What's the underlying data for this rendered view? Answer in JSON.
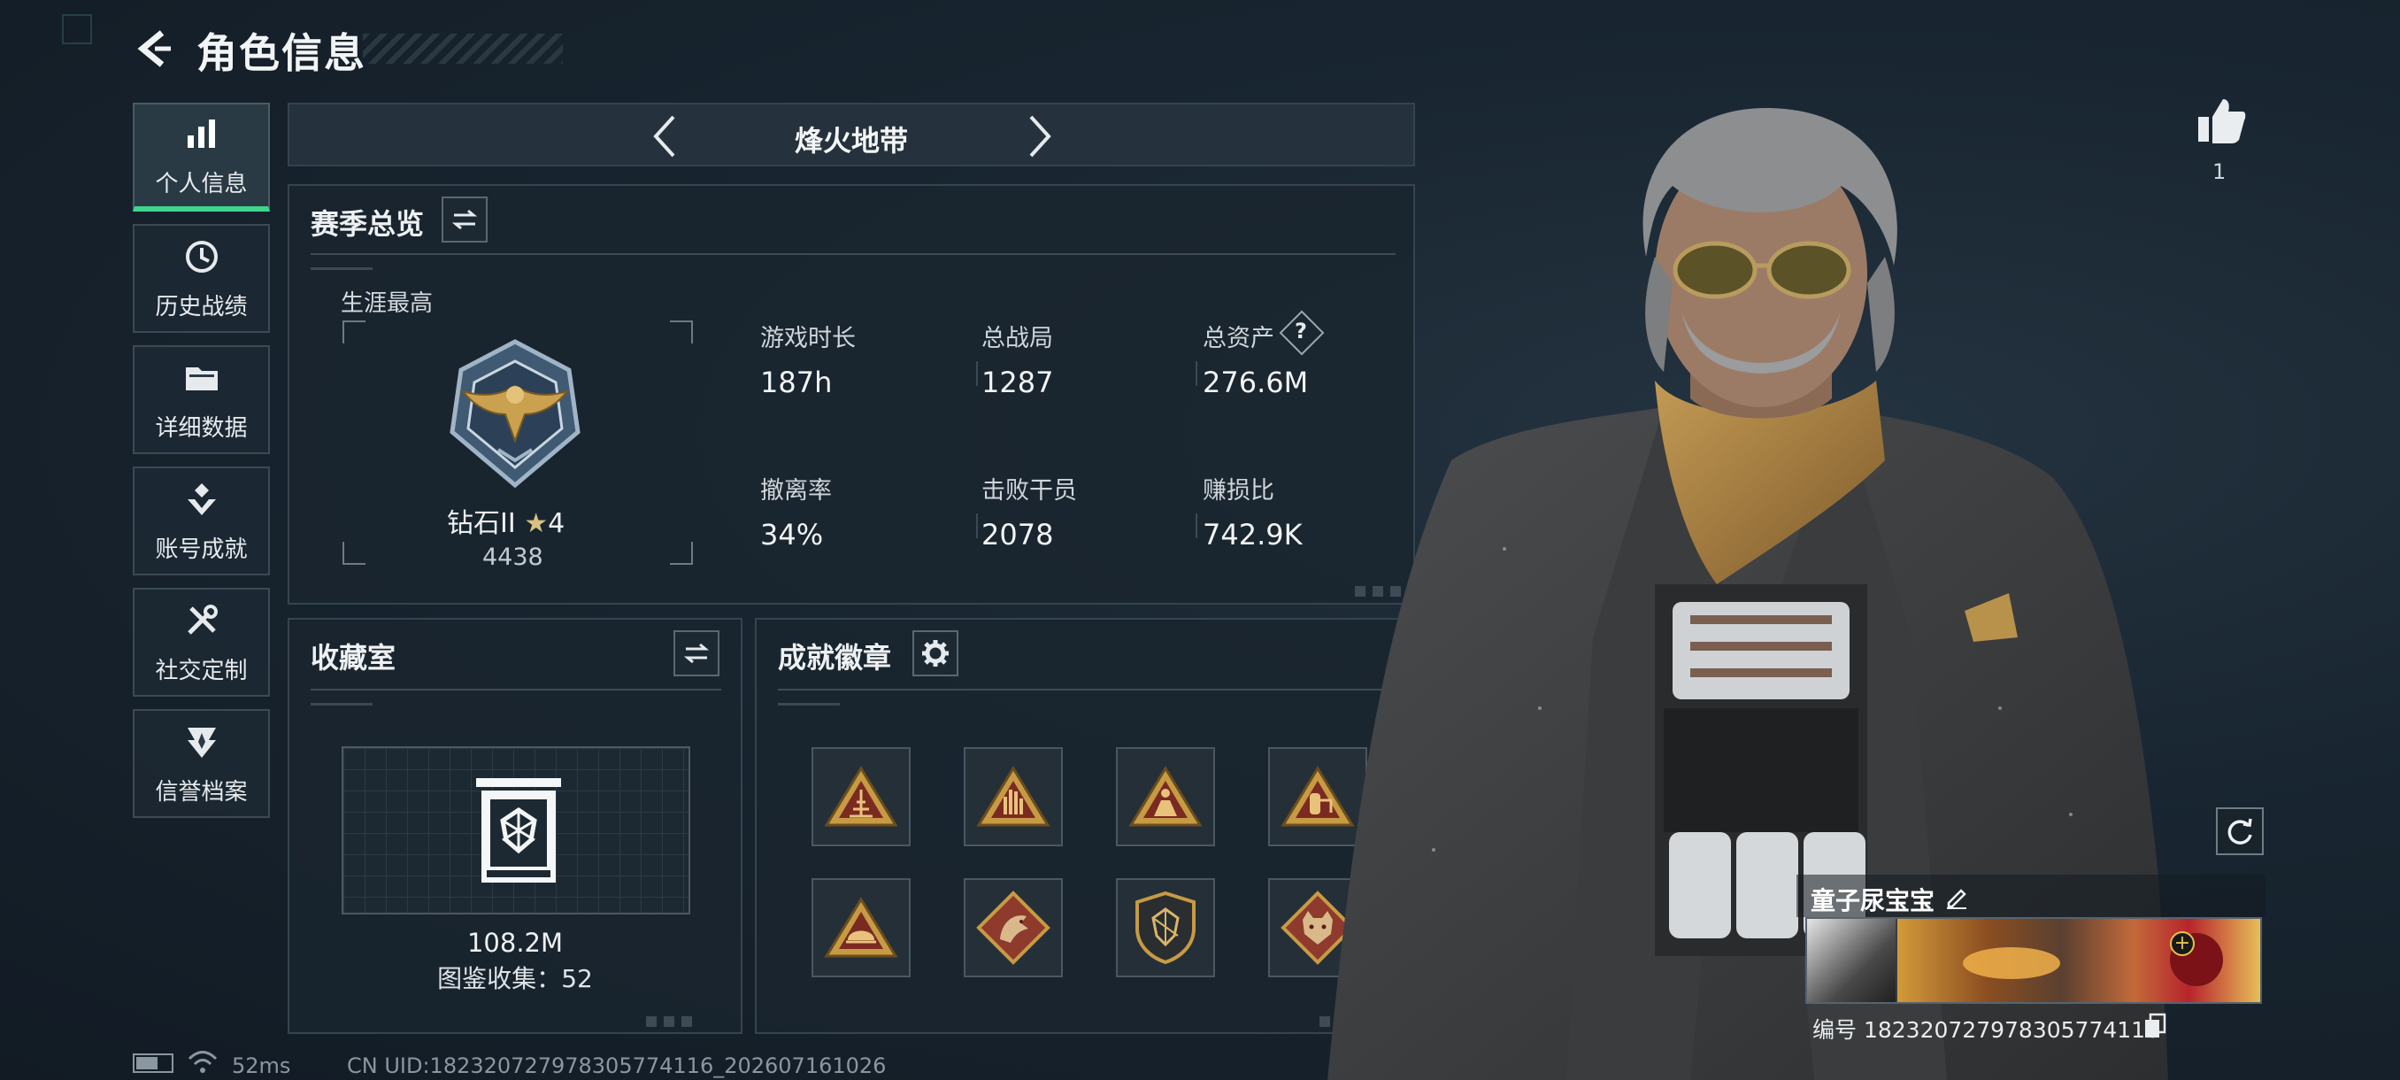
{
  "header": {
    "title": "角色信息"
  },
  "sidebar": {
    "items": [
      {
        "label": "个人信息",
        "icon": "bar-chart-icon",
        "active": true
      },
      {
        "label": "历史战绩",
        "icon": "history-clock-icon"
      },
      {
        "label": "详细数据",
        "icon": "folder-icon"
      },
      {
        "label": "账号成就",
        "icon": "achievement-medal-icon"
      },
      {
        "label": "社交定制",
        "icon": "tools-icon"
      },
      {
        "label": "信誉档案",
        "icon": "shield-emblem-icon"
      }
    ]
  },
  "mode_selector": {
    "current": "烽火地带"
  },
  "season_overview": {
    "title": "赛季总览",
    "career_high_label": "生涯最高",
    "rank_name": "钻石II",
    "rank_stars": "4",
    "rank_score": "4438",
    "stats": [
      {
        "label": "游戏时长",
        "value": "187h"
      },
      {
        "label": "总战局",
        "value": "1287"
      },
      {
        "label": "总资产",
        "value": "276.6M",
        "has_help": true
      },
      {
        "label": "撤离率",
        "value": "34%"
      },
      {
        "label": "击败干员",
        "value": "2078"
      },
      {
        "label": "赚损比",
        "value": "742.9K"
      }
    ]
  },
  "collection": {
    "title": "收藏室",
    "value": "108.2M",
    "catalog_label": "图鉴收集：",
    "catalog_count": "52"
  },
  "achievements": {
    "title": "成就徽章",
    "badges": [
      "triangle-structure-badge-icon",
      "triangle-hand-badge-icon",
      "triangle-figure-badge-icon",
      "triangle-tank-badge-icon",
      "triangle-helmet-badge-icon",
      "diamond-dragon-badge-icon",
      "shield-gem-badge-icon",
      "diamond-wolf-badge-icon"
    ]
  },
  "likes": {
    "count": "1"
  },
  "player": {
    "name": "童子尿宝宝",
    "id_label": "编号",
    "id_value": "1823207279783057741​16"
  },
  "footer": {
    "ping": "52ms",
    "uid_text": "CN UID:182320727978305774116_202607161026"
  },
  "colors": {
    "accent_green": "#3dd68c",
    "badge_gold": "#c49a4a",
    "badge_red": "#8b2d24"
  }
}
